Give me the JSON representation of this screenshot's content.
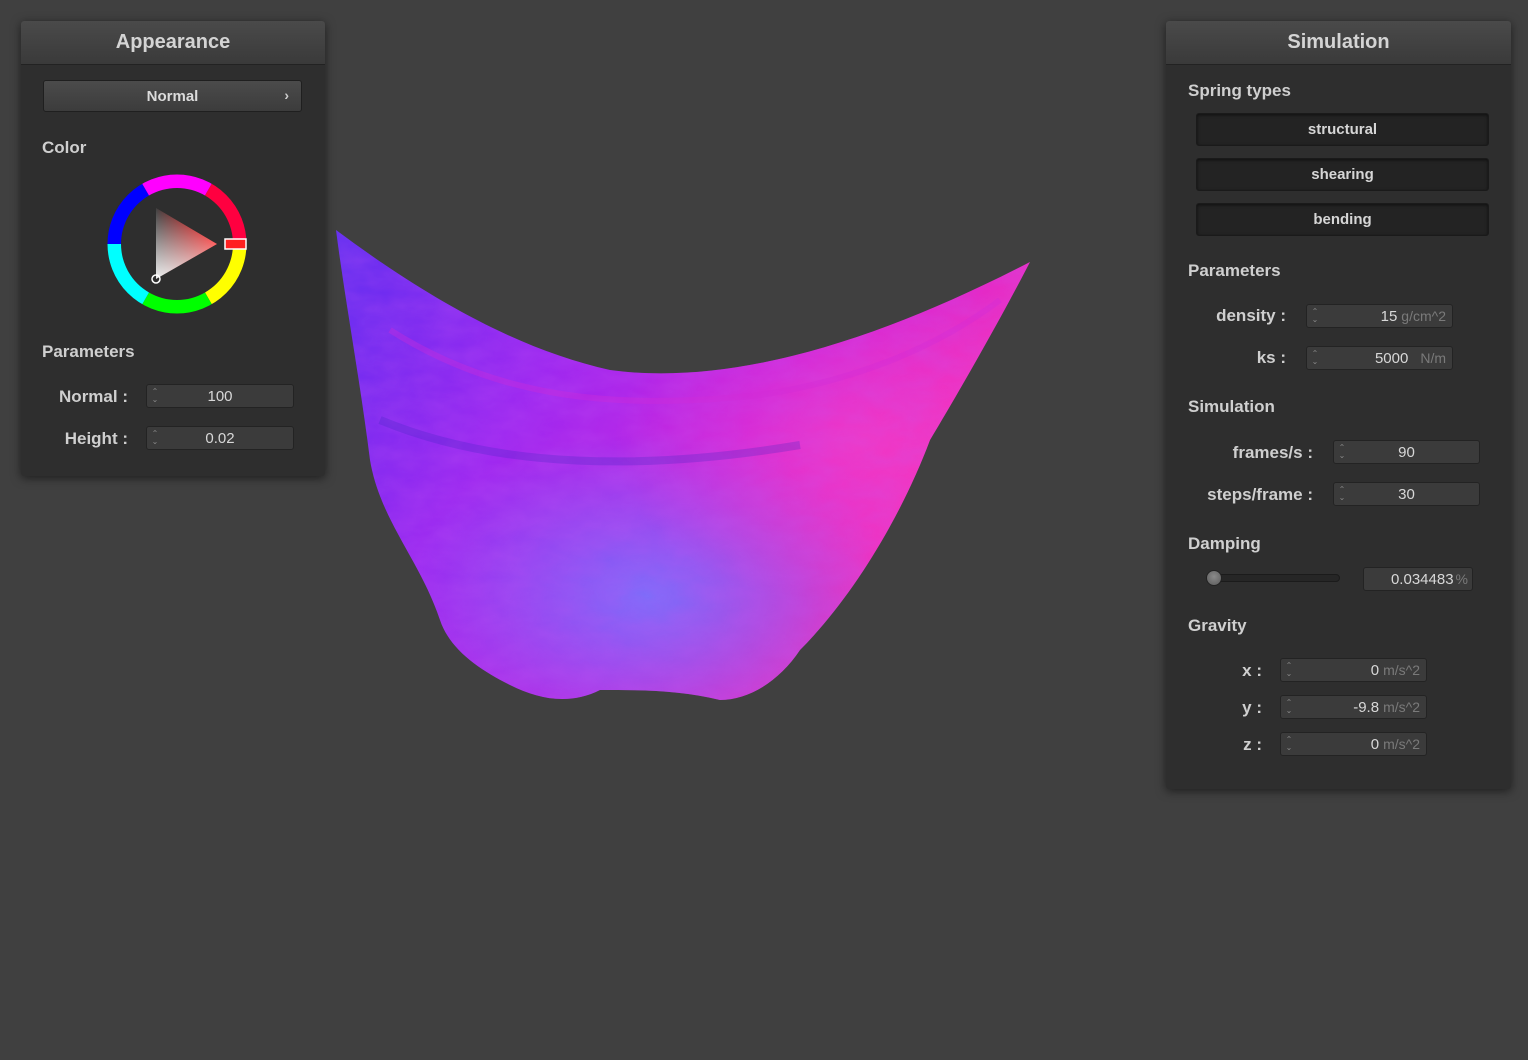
{
  "appearance": {
    "title": "Appearance",
    "shader_label": "Normal",
    "color_title": "Color",
    "color": "#ff0000",
    "parameters_title": "Parameters",
    "normal_label": "Normal :",
    "normal_value": "100",
    "height_label": "Height :",
    "height_value": "0.02"
  },
  "simulation": {
    "title": "Simulation",
    "spring_types_title": "Spring types",
    "spring_types": [
      "structural",
      "shearing",
      "bending"
    ],
    "parameters_title": "Parameters",
    "density_label": "density :",
    "density_value": "15",
    "density_unit": "g/cm^2",
    "ks_label": "ks :",
    "ks_value": "5000",
    "ks_unit": "N/m",
    "sim_title": "Simulation",
    "fps_label": "frames/s :",
    "fps_value": "90",
    "steps_label": "steps/frame :",
    "steps_value": "30",
    "damping_title": "Damping",
    "damping_value": "0.034483",
    "damping_unit": "%",
    "gravity_title": "Gravity",
    "gx_label": "x :",
    "gx_value": "0",
    "gy_label": "y :",
    "gy_value": "-9.8",
    "gz_label": "z :",
    "gz_value": "0",
    "gravity_unit": "m/s^2"
  },
  "colors": {
    "background": "#404040",
    "panel": "#2e2e2e",
    "cloth_primary": "#a020f0",
    "cloth_accent": "#ff2fb0",
    "cloth_blue": "#4060ff"
  }
}
